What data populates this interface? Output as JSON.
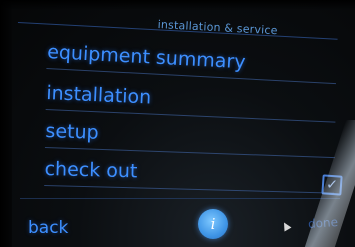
{
  "header": {
    "title": "installation & service"
  },
  "menu": {
    "items": [
      {
        "label": "equipment summary"
      },
      {
        "label": "installation"
      },
      {
        "label": "setup"
      },
      {
        "label": "check out"
      }
    ]
  },
  "footer": {
    "back_label": "back",
    "info_label": "i",
    "done_label": "done"
  },
  "checkbox": {
    "checked": true,
    "glyph": "✓"
  },
  "colors": {
    "accent": "#3d8fff",
    "title": "#5b97d6",
    "background": "#0b0e11",
    "info_button": "#3f95e6"
  }
}
